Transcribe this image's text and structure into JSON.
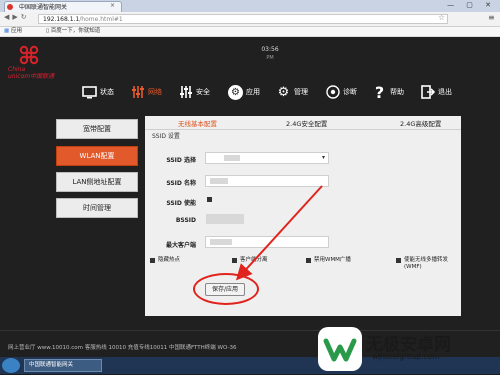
{
  "browser": {
    "tab_title": "中国联通智能网关",
    "tab_close": "×",
    "window_controls": "— ▢ ✕",
    "url_prefix": "192.168.1.1",
    "url_path": "/home.html#1",
    "bookmark_apps": "应用",
    "bookmark_2": "百度一下，你就知道"
  },
  "header": {
    "logo_text_line1": "China",
    "logo_text_line2": "unicom中国联通",
    "time": "03:56",
    "date": "PM"
  },
  "navbar": {
    "items": [
      {
        "label": "状态",
        "icon": "monitor-icon"
      },
      {
        "label": "网络",
        "icon": "network-icon"
      },
      {
        "label": "安全",
        "icon": "security-icon"
      },
      {
        "label": "应用",
        "icon": "gear-icon"
      },
      {
        "label": "管理",
        "icon": "settings-icon"
      },
      {
        "label": "诊断",
        "icon": "diagnose-icon"
      },
      {
        "label": "帮助",
        "icon": "help-icon"
      },
      {
        "label": "退出",
        "icon": "exit-icon"
      }
    ],
    "active": "网络"
  },
  "sidebar": {
    "items": [
      {
        "label": "宽带配置"
      },
      {
        "label": "WLAN配置"
      },
      {
        "label": "LAN侧地址配置"
      },
      {
        "label": "时间管理"
      }
    ],
    "active": "WLAN配置"
  },
  "content": {
    "tabs": [
      {
        "label": "无线基本配置"
      },
      {
        "label": "2.4G安全配置"
      },
      {
        "label": "2.4G高级配置"
      }
    ],
    "section_title": "SSID 设置",
    "fields": {
      "ssid_select_label": "SSID 选择",
      "ssid_select_arrow": "▾",
      "ssid_name_label": "SSID 名称",
      "ssid_enable_label": "SSID 使能",
      "bssid_label": "BSSID",
      "max_clients_label": "最大客户端"
    },
    "options": [
      {
        "label": "隐藏热点"
      },
      {
        "label": "客户端分离"
      },
      {
        "label": "禁用WMM广播"
      },
      {
        "label": "使能无线多播转发(WMF)"
      }
    ],
    "save_label": "保存/应用"
  },
  "footer": {
    "text": "网上营业厅 www.10010.com 客服热线 10010 充值专线10011 中国联通FTTH终端 WO-36"
  },
  "taskbar": {
    "task_label": "中国联通智能网关"
  },
  "watermark": {
    "title": "无极安卓网",
    "url": "wjhotelgroup.com"
  },
  "colors": {
    "accent": "#e2592b",
    "highlight_ring": "#e0241d",
    "background": "#202020"
  }
}
